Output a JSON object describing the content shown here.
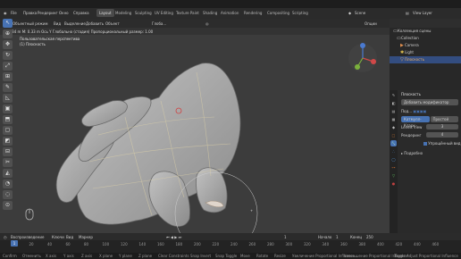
{
  "topbar": {
    "menus": [
      "File",
      "Правка",
      "Рендеринг",
      "Окно",
      "Справка"
    ],
    "workspaces": [
      "Layout",
      "Modeling",
      "Sculpting",
      "UV Editing",
      "Texture Paint",
      "Shading",
      "Animation",
      "Rendering",
      "Compositing",
      "Scripting"
    ],
    "active_workspace": "Layout",
    "scene_label": "Scene",
    "view_layer_label": "View Layer"
  },
  "viewport": {
    "mode_label": "Объектный режим",
    "view_menu": "Вид",
    "select_menu": "Выделение",
    "add_menu": "Добавить",
    "object_menu": "Объект",
    "transform_label": "Глоба...",
    "options_label": "Опции",
    "hint_text": "X: 0.34 m  M: 0.33 m  Ось Y  Глобально (стадия)   Пропорциональный размер: 1.00",
    "view_title": "Пользовательская перспектива",
    "object_name": "(1) Плоскость"
  },
  "toolbar": {
    "tools": [
      "cursor-select",
      "move",
      "rotate",
      "scale",
      "transform",
      "annotate",
      "measure",
      "add-cube",
      "extrude",
      "inset",
      "bevel",
      "loop-cut",
      "knife",
      "poly-build",
      "spin",
      "smooth",
      "shrink",
      "shear",
      "rip"
    ],
    "active_index": 0
  },
  "outliner": {
    "root": "Коллекция сцены",
    "items": [
      {
        "label": "Collection",
        "selected": false
      },
      {
        "label": "Camera",
        "selected": false
      },
      {
        "label": "Light",
        "selected": false
      },
      {
        "label": "Плоскость",
        "selected": true
      }
    ]
  },
  "properties": {
    "object_name": "Плоскость",
    "add_modifier": "Добавить модификатор",
    "modifier_name": "Под...",
    "tab_catmull": "Катмулл-Кларк",
    "tab_simple": "Простой",
    "levels_view_label": "Levels View",
    "levels_view_value": "3",
    "render_label": "Рендеринг",
    "render_value": "4",
    "optimal_label": "Упрощённый вид",
    "advanced_label": "Подробно"
  },
  "timeline": {
    "playback": "Воспроизведение",
    "keying": "Ключи",
    "view": "Вид",
    "marker": "Маркер",
    "current_frame": "1",
    "start_label": "Начало",
    "start_value": "1",
    "end_label": "Конец",
    "end_value": "250",
    "ticks": [
      "1",
      "20",
      "40",
      "60",
      "80",
      "100",
      "120",
      "140",
      "160",
      "180",
      "200",
      "220",
      "240",
      "260",
      "280",
      "300",
      "320",
      "340",
      "360",
      "380",
      "400",
      "420",
      "440",
      "460"
    ]
  },
  "statusbar": {
    "items": [
      "Confirm",
      "Отменить",
      "X axis",
      "Y axis",
      "Z axis",
      "X plane",
      "Y plane",
      "Z plane",
      "Clear Constraints",
      "Snap Invert",
      "Snap Toggle",
      "Move",
      "Rotate",
      "Resize",
      "Увеличение Proportional Influence",
      "Уменьшение Proportional Influence",
      "Toggle Adjust Proportional Influence"
    ]
  },
  "colors": {
    "accent": "#4772b3",
    "viewport_bg": "#3c3c3c",
    "panel_bg": "#2a2a2a",
    "mesh": "#a3a3a3",
    "wire": "#e6d8a8"
  }
}
